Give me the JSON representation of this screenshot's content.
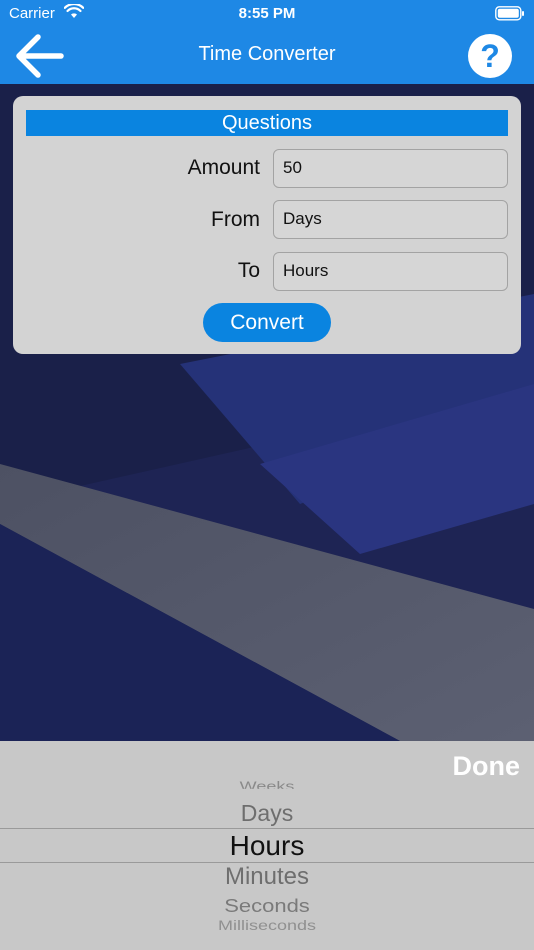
{
  "status": {
    "carrier": "Carrier",
    "time": "8:55 PM"
  },
  "nav": {
    "title": "Time Converter",
    "help_symbol": "?"
  },
  "card": {
    "header": "Questions",
    "amount_label": "Amount",
    "amount_value": "50",
    "from_label": "From",
    "from_value": "Days",
    "to_label": "To",
    "to_value": "Hours",
    "convert_label": "Convert"
  },
  "picker": {
    "done_label": "Done",
    "items": [
      "Weeks",
      "Days",
      "Hours",
      "Minutes",
      "Seconds",
      "Milliseconds"
    ],
    "selected": "Hours"
  },
  "colors": {
    "header": "#1e88e5",
    "accent": "#0a84e0",
    "card": "#d3d3d3",
    "picker": "#c8c8c8"
  }
}
